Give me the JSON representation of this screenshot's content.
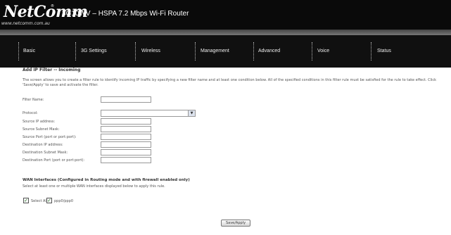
{
  "header": {
    "logo": "NetComm",
    "logo_tm": "®",
    "logo_url": "www.netcomm.com.au",
    "title": "3G10WV – HSPA 7.2 Mbps Wi-Fi Router"
  },
  "nav": [
    "Basic",
    "3G Settings",
    "Wireless",
    "Management",
    "Advanced",
    "Voice",
    "Status"
  ],
  "page": {
    "title": "Add IP Filter -- Incoming",
    "description": "The screen allows you to create a filter rule to identify incoming IP traffic by specifying a new filter name and at least one condition below. All of the specified conditions in this filter rule must be satisfied for the rule to take effect. Click 'Save/Apply' to save and activate the filter."
  },
  "form": {
    "filter_name": "Filter Name:",
    "protocol": "Protocol:",
    "protocol_value": "",
    "source_ip": "Source IP address:",
    "source_mask": "Source Subnet Mask:",
    "source_port": "Source Port (port or port:port):",
    "dest_ip": "Destination IP address:",
    "dest_mask": "Destination Subnet Mask:",
    "dest_port": "Destination Port (port or port:port):"
  },
  "wan": {
    "title": "WAN Interfaces (Configured in Routing mode and with firewall enabled only)",
    "description": "Select at least one or multiple WAN interfaces displayed below to apply this rule.",
    "select_all": "Select All",
    "interface": "ppp0/ppp0"
  },
  "apply_label": "Save/Apply"
}
